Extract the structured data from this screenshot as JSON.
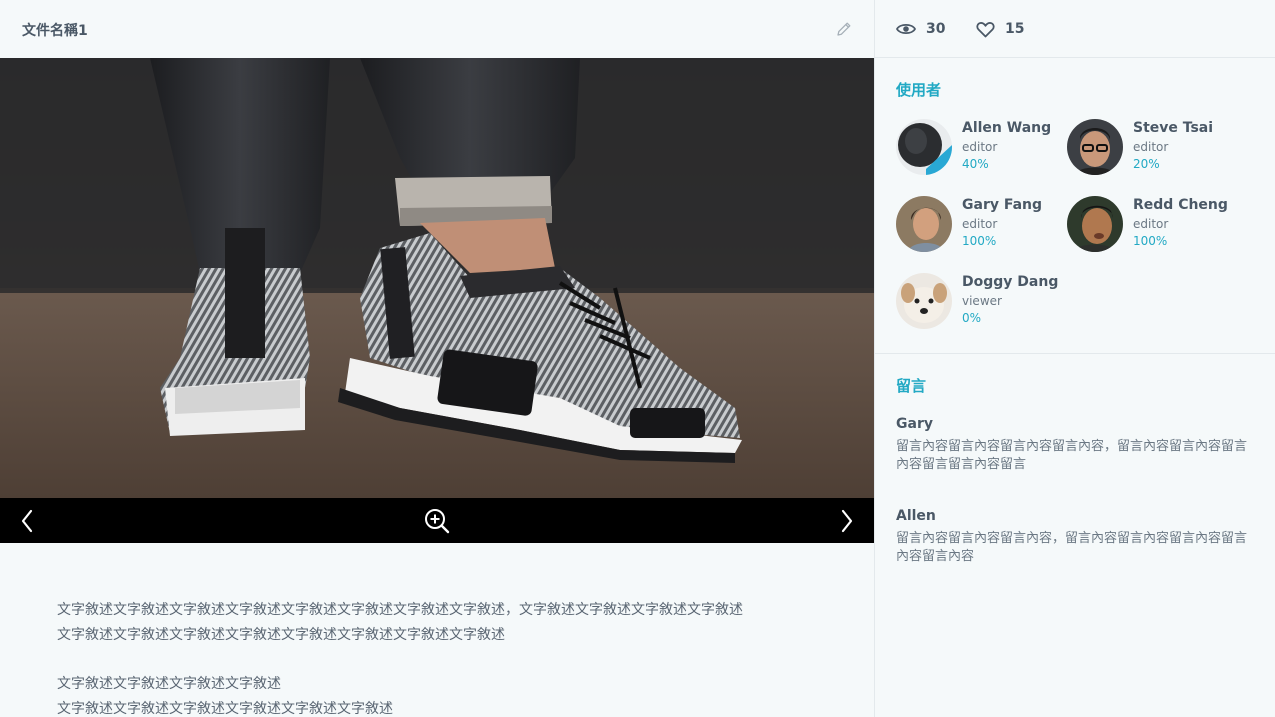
{
  "document": {
    "title": "文件名稱1",
    "description": [
      "文字敘述文字敘述文字敘述文字敘述文字敘述文字敘述文字敘述文字敘述，文字敘述文字敘述文字敘述文字敘述",
      "文字敘述文字敘述文字敘述文字敘述文字敘述文字敘述文字敘述文字敘述",
      "",
      "文字敘述文字敘述文字敘述文字敘述",
      "文字敘述文字敘述文字敘述文字敘述文字敘述文字敘述"
    ]
  },
  "stats": {
    "views": "30",
    "likes": "15"
  },
  "users": {
    "title": "使用者",
    "list": [
      {
        "name": "Allen Wang",
        "role": "editor",
        "percent": "40%"
      },
      {
        "name": "Steve Tsai",
        "role": "editor",
        "percent": "20%"
      },
      {
        "name": "Gary Fang",
        "role": "editor",
        "percent": "100%"
      },
      {
        "name": "Redd Cheng",
        "role": "editor",
        "percent": "100%"
      },
      {
        "name": "Doggy Dang",
        "role": "viewer",
        "percent": "0%"
      }
    ]
  },
  "comments": {
    "title": "留言",
    "list": [
      {
        "author": "Gary",
        "text": "留言內容留言內容留言內容留言內容，留言內容留言內容留言內容留言留言內容留言"
      },
      {
        "author": "Allen",
        "text": "留言內容留言內容留言內容，留言內容留言內容留言內容留言內容留言內容"
      }
    ]
  },
  "colors": {
    "accent": "#22a9c4",
    "background": "#f5f9fa",
    "photo_bar": "#000000"
  },
  "icons": {
    "edit": "pencil-icon",
    "views": "eye-icon",
    "likes": "heart-icon",
    "prev": "chevron-left-icon",
    "next": "chevron-right-icon",
    "zoom": "zoom-in-icon"
  }
}
